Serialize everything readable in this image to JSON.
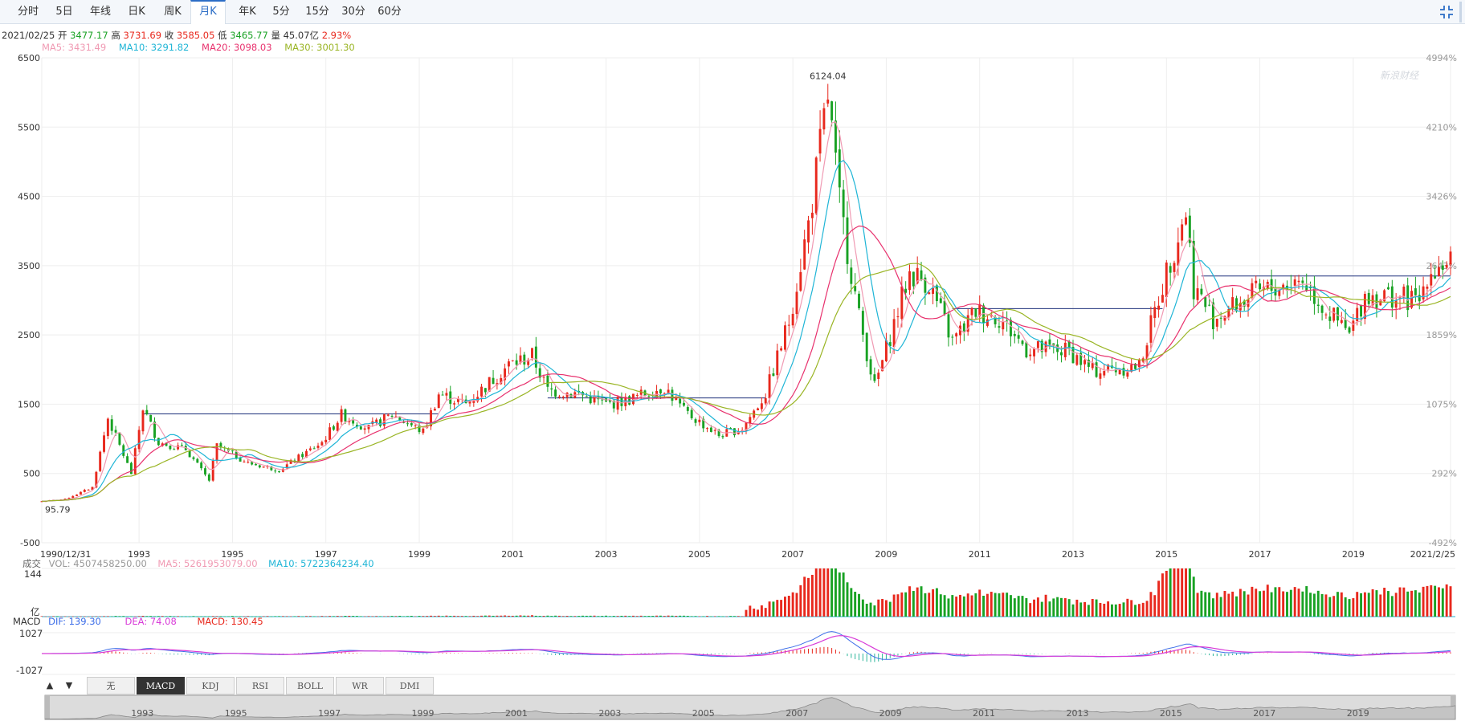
{
  "tabs": [
    {
      "label": "分时",
      "active": false
    },
    {
      "label": "5日",
      "active": false
    },
    {
      "label": "年线",
      "active": false
    },
    {
      "label": "日K",
      "active": false
    },
    {
      "label": "周K",
      "active": false
    },
    {
      "label": "月K",
      "active": true
    },
    {
      "label": "年K",
      "active": false
    },
    {
      "label": "5分",
      "active": false
    },
    {
      "label": "15分",
      "active": false
    },
    {
      "label": "30分",
      "active": false
    },
    {
      "label": "60分",
      "active": false
    }
  ],
  "quote": {
    "date": "2021/02/25",
    "open_label": "开",
    "open": "3477.17",
    "high_label": "高",
    "high": "3731.69",
    "close_label": "收",
    "close": "3585.05",
    "low_label": "低",
    "low": "3465.77",
    "vol_label": "量",
    "vol": "45.07亿",
    "change": "2.93%"
  },
  "ma_legend": {
    "ma5": "MA5: 3431.49",
    "ma10": "MA10: 3291.82",
    "ma20": "MA20: 3098.03",
    "ma30": "MA30: 3001.30"
  },
  "volume_legend": {
    "title": "成交",
    "vol": "VOL: 4507458250.00",
    "ma5": "MA5: 5261953079.00",
    "ma10": "MA10: 5722364234.40",
    "top_tick": "144",
    "unit": "亿"
  },
  "macd_legend": {
    "title": "MACD",
    "dif": "DIF: 139.30",
    "dea": "DEA: 74.08",
    "macd": "MACD: 130.45",
    "top_tick": "1027",
    "bottom_tick": "-1027"
  },
  "indicator_tabs": [
    "无",
    "MACD",
    "KDJ",
    "RSI",
    "BOLL",
    "WR",
    "DMI"
  ],
  "active_indicator": "MACD",
  "watermark": "新浪财经",
  "chart_data": {
    "type": "candlestick",
    "title": "",
    "period": "monthly",
    "ylim": [
      -500,
      6500
    ],
    "y_ticks": [
      -500,
      500,
      1500,
      2500,
      3500,
      4500,
      5500,
      6500
    ],
    "y_right_ticks": [
      "-492%",
      "292%",
      "1075%",
      "1859%",
      "2643%",
      "3426%",
      "4210%",
      "4994%"
    ],
    "x_ticks": [
      "1990/12/31",
      "1993",
      "1995",
      "1997",
      "1999",
      "2001",
      "2003",
      "2005",
      "2007",
      "2009",
      "2011",
      "2013",
      "2015",
      "2017",
      "2019",
      "2021/2/25"
    ],
    "navigator_ticks": [
      "1993",
      "1995",
      "1997",
      "1999",
      "2001",
      "2003",
      "2005",
      "2007",
      "2009",
      "2011",
      "2013",
      "2015",
      "2017",
      "2019"
    ],
    "annotations": [
      {
        "text": "6124.04",
        "date": "2007-10",
        "value": 6124.04,
        "kind": "max"
      },
      {
        "text": "95.79",
        "date": "1990-12",
        "value": 95.79,
        "kind": "min"
      }
    ],
    "colors": {
      "up": "#e8281d",
      "down": "#19a224",
      "ma5": "#f09ab3",
      "ma10": "#1fb5d6",
      "ma20": "#e8326e",
      "ma30": "#9ab525",
      "dif": "#3c6de8",
      "dea": "#d83ad8"
    },
    "close_path": [
      [
        "1990-12",
        99
      ],
      [
        "1991-06",
        130
      ],
      [
        "1992-01",
        300
      ],
      [
        "1992-05",
        1300
      ],
      [
        "1992-11",
        500
      ],
      [
        "1993-02",
        1450
      ],
      [
        "1993-06",
        950
      ],
      [
        "1994-01",
        850
      ],
      [
        "1994-07",
        400
      ],
      [
        "1994-09",
        900
      ],
      [
        "1995-05",
        650
      ],
      [
        "1996-01",
        550
      ],
      [
        "1996-12",
        950
      ],
      [
        "1997-05",
        1350
      ],
      [
        "1997-12",
        1150
      ],
      [
        "1998-06",
        1350
      ],
      [
        "1999-02",
        1100
      ],
      [
        "1999-06",
        1650
      ],
      [
        "2000-01",
        1500
      ],
      [
        "2000-12",
        2070
      ],
      [
        "2001-06",
        2200
      ],
      [
        "2001-10",
        1700
      ],
      [
        "2002-06",
        1650
      ],
      [
        "2003-01",
        1500
      ],
      [
        "2003-06",
        1550
      ],
      [
        "2004-04",
        1750
      ],
      [
        "2004-09",
        1400
      ],
      [
        "2005-06",
        1050
      ],
      [
        "2005-12",
        1150
      ],
      [
        "2006-06",
        1650
      ],
      [
        "2006-12",
        2700
      ],
      [
        "2007-05",
        4100
      ],
      [
        "2007-10",
        5950
      ],
      [
        "2008-01",
        4400
      ],
      [
        "2008-06",
        2750
      ],
      [
        "2008-10",
        1750
      ],
      [
        "2009-07",
        3400
      ],
      [
        "2009-12",
        3250
      ],
      [
        "2010-06",
        2400
      ],
      [
        "2010-12",
        2850
      ],
      [
        "2011-06",
        2750
      ],
      [
        "2012-01",
        2300
      ],
      [
        "2012-12",
        2270
      ],
      [
        "2013-06",
        1980
      ],
      [
        "2014-06",
        2050
      ],
      [
        "2014-12",
        3230
      ],
      [
        "2015-06",
        4300
      ],
      [
        "2015-08",
        3200
      ],
      [
        "2016-01",
        2740
      ],
      [
        "2016-12",
        3100
      ],
      [
        "2017-12",
        3300
      ],
      [
        "2018-06",
        2850
      ],
      [
        "2018-12",
        2500
      ],
      [
        "2019-04",
        3080
      ],
      [
        "2019-12",
        3050
      ],
      [
        "2020-06",
        2980
      ],
      [
        "2020-08",
        3400
      ],
      [
        "2021-02",
        3585
      ]
    ],
    "support_lines": [
      {
        "from": "1993-02",
        "to": "1999-06",
        "value": 1360
      },
      {
        "from": "2001-10",
        "to": "2006-06",
        "value": 1590
      },
      {
        "from": "2010-06",
        "to": "2014-12",
        "value": 2880
      },
      {
        "from": "2015-10",
        "to": "2021-02",
        "value": 3350
      }
    ],
    "volume": {
      "ylim": [
        0,
        144
      ],
      "unit": "亿"
    },
    "macd": {
      "ylim": [
        -1027,
        1027
      ]
    }
  }
}
